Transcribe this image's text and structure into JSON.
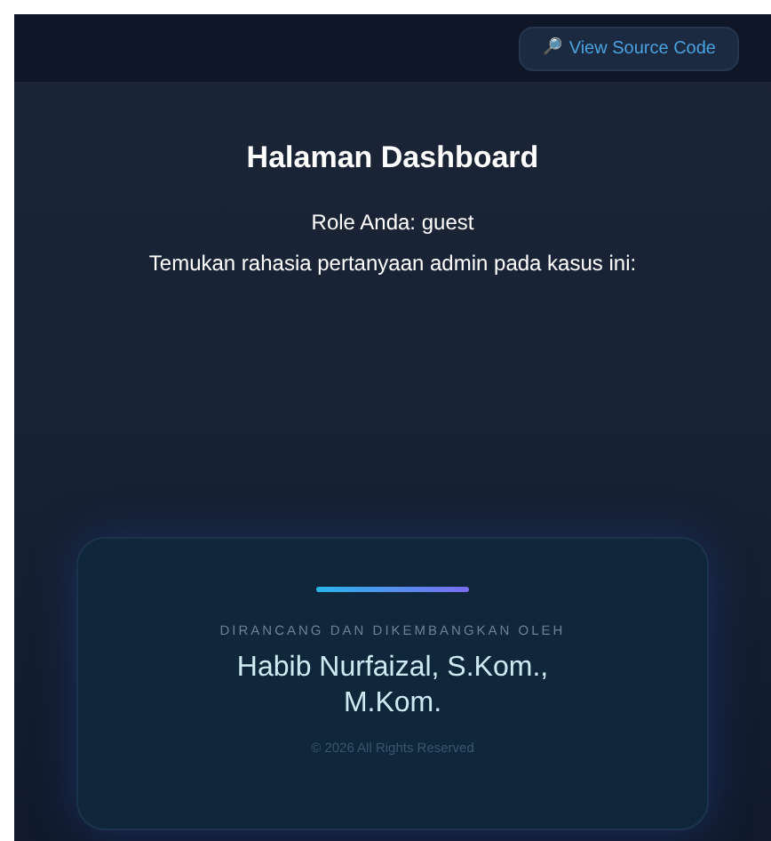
{
  "header": {
    "source_button": {
      "icon": "🔎",
      "label": "View Source Code"
    }
  },
  "main": {
    "title": "Halaman Dashboard",
    "role_line": "Role Anda: guest",
    "instruction": "Temukan rahasia pertanyaan admin pada kasus ini:"
  },
  "footer_card": {
    "caption": "DIRANCANG DAN DIKEMBANGKAN OLEH",
    "author": "Habib Nurfaizal, S.Kom., M.Kom.",
    "copyright": "© 2026 All Rights Reserved"
  }
}
